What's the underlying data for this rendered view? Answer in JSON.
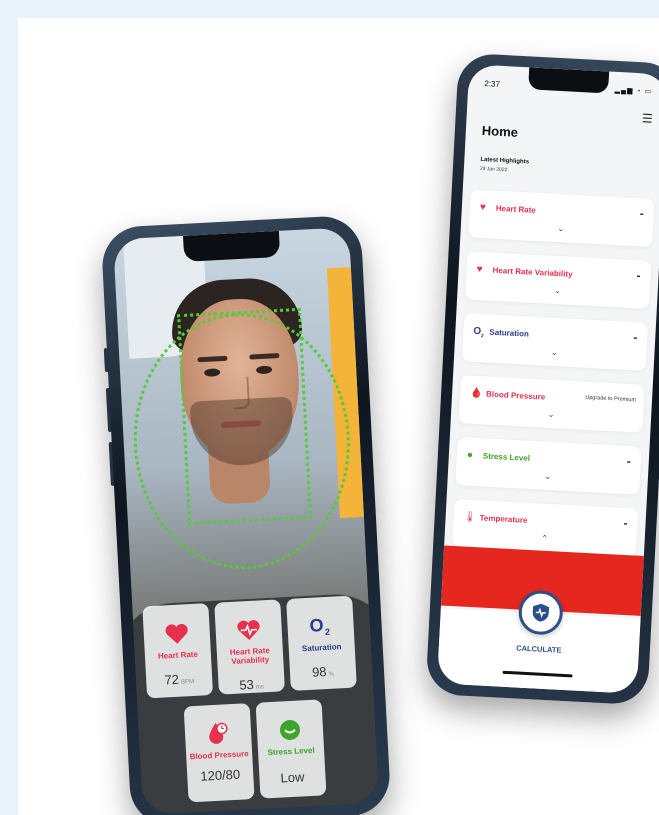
{
  "left_phone": {
    "metrics": [
      {
        "label": "Heart Rate",
        "value": "72",
        "unit": "BPM",
        "color": "#e8304f",
        "icon": "heart-icon"
      },
      {
        "label": "Heart Rate Variability",
        "value": "53",
        "unit": "ms",
        "color": "#e8304f",
        "icon": "heart-wave-icon"
      },
      {
        "label": "Saturation",
        "value": "98",
        "unit": "%",
        "color": "#2c3b8f",
        "icon": "o2-icon"
      },
      {
        "label": "Blood Pressure",
        "value": "120/80",
        "unit": "",
        "color": "#e8304f",
        "icon": "blood-pressure-icon"
      },
      {
        "label": "Stress Level",
        "value": "Low",
        "unit": "",
        "color": "#3ea52a",
        "icon": "stress-icon"
      }
    ]
  },
  "right_phone": {
    "status": {
      "time": "2:37"
    },
    "title": "Home",
    "highlights_label": "Latest Highlights",
    "highlights_date": "29 Jan 2022",
    "cards": [
      {
        "name": "Heart Rate",
        "value": "-",
        "color": "#e8304f",
        "icon": "heart-icon"
      },
      {
        "name": "Heart Rate Variability",
        "value": "-",
        "color": "#e8304f",
        "icon": "heart-wave-icon"
      },
      {
        "name": "Saturation",
        "value": "-",
        "color": "#2c3b8f",
        "icon": "o2-icon"
      },
      {
        "name": "Blood Pressure",
        "value": "Upgrade to Premium",
        "color": "#e8304f",
        "icon": "blood-pressure-icon"
      },
      {
        "name": "Stress Level",
        "value": "-",
        "color": "#3ea52a",
        "icon": "stress-icon"
      },
      {
        "name": "Temperature",
        "value": "-",
        "color": "#e8304f",
        "icon": "thermometer-icon"
      }
    ],
    "calculate_label": "CALCULATE"
  }
}
